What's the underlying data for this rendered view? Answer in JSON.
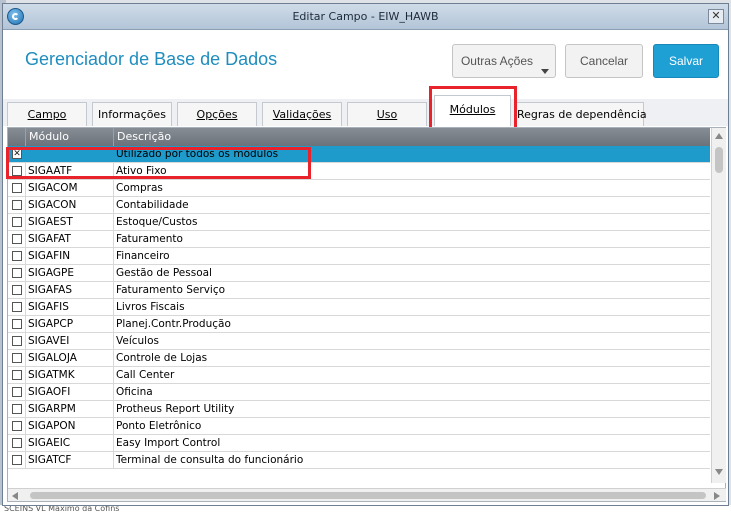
{
  "window": {
    "title": "Editar Campo - EIW_HAWB",
    "close_symbol": "✕"
  },
  "header": {
    "title": "Gerenciador de Base de Dados",
    "buttons": {
      "outras": "Outras Ações",
      "cancelar": "Cancelar",
      "salvar": "Salvar"
    }
  },
  "tabs": [
    {
      "label": "Campo"
    },
    {
      "label": "Informações"
    },
    {
      "label": "Opções"
    },
    {
      "label": "Validações"
    },
    {
      "label": "Uso"
    },
    {
      "label": "Módulos",
      "active": true
    },
    {
      "label": "Regras de dependência"
    }
  ],
  "grid": {
    "columns": [
      "Módulo",
      "Descrição"
    ],
    "rows": [
      {
        "modulo": "",
        "descricao": "Utilizado por todos os módulos",
        "checked": true,
        "selected": true
      },
      {
        "modulo": "SIGAATF",
        "descricao": "Ativo Fixo",
        "checked": false
      },
      {
        "modulo": "SIGACOM",
        "descricao": "Compras",
        "checked": false
      },
      {
        "modulo": "SIGACON",
        "descricao": "Contabilidade",
        "checked": false
      },
      {
        "modulo": "SIGAEST",
        "descricao": "Estoque/Custos",
        "checked": false
      },
      {
        "modulo": "SIGAFAT",
        "descricao": "Faturamento",
        "checked": false
      },
      {
        "modulo": "SIGAFIN",
        "descricao": "Financeiro",
        "checked": false
      },
      {
        "modulo": "SIGAGPE",
        "descricao": "Gestão de Pessoal",
        "checked": false
      },
      {
        "modulo": "SIGAFAS",
        "descricao": "Faturamento Serviço",
        "checked": false
      },
      {
        "modulo": "SIGAFIS",
        "descricao": "Livros Fiscais",
        "checked": false
      },
      {
        "modulo": "SIGAPCP",
        "descricao": "Planej.Contr.Produção",
        "checked": false
      },
      {
        "modulo": "SIGAVEI",
        "descricao": "Veículos",
        "checked": false
      },
      {
        "modulo": "SIGALOJA",
        "descricao": "Controle de Lojas",
        "checked": false
      },
      {
        "modulo": "SIGATMK",
        "descricao": "Call Center",
        "checked": false
      },
      {
        "modulo": "SIGAOFI",
        "descricao": "Oficina",
        "checked": false
      },
      {
        "modulo": "SIGARPM",
        "descricao": "Protheus Report Utility",
        "checked": false
      },
      {
        "modulo": "SIGAPON",
        "descricao": "Ponto Eletrônico",
        "checked": false
      },
      {
        "modulo": "SIGAEIC",
        "descricao": "Easy Import Control",
        "checked": false
      },
      {
        "modulo": "SIGATCF",
        "descricao": "Terminal de consulta do funcionário",
        "checked": false
      }
    ]
  },
  "background_text": "SCEINS     VL Maximo da Cofins",
  "colors": {
    "accent": "#1fa0d4",
    "title": "#1f8dbe",
    "selected_row": "#1e9acb",
    "highlight": "#e8232b"
  }
}
